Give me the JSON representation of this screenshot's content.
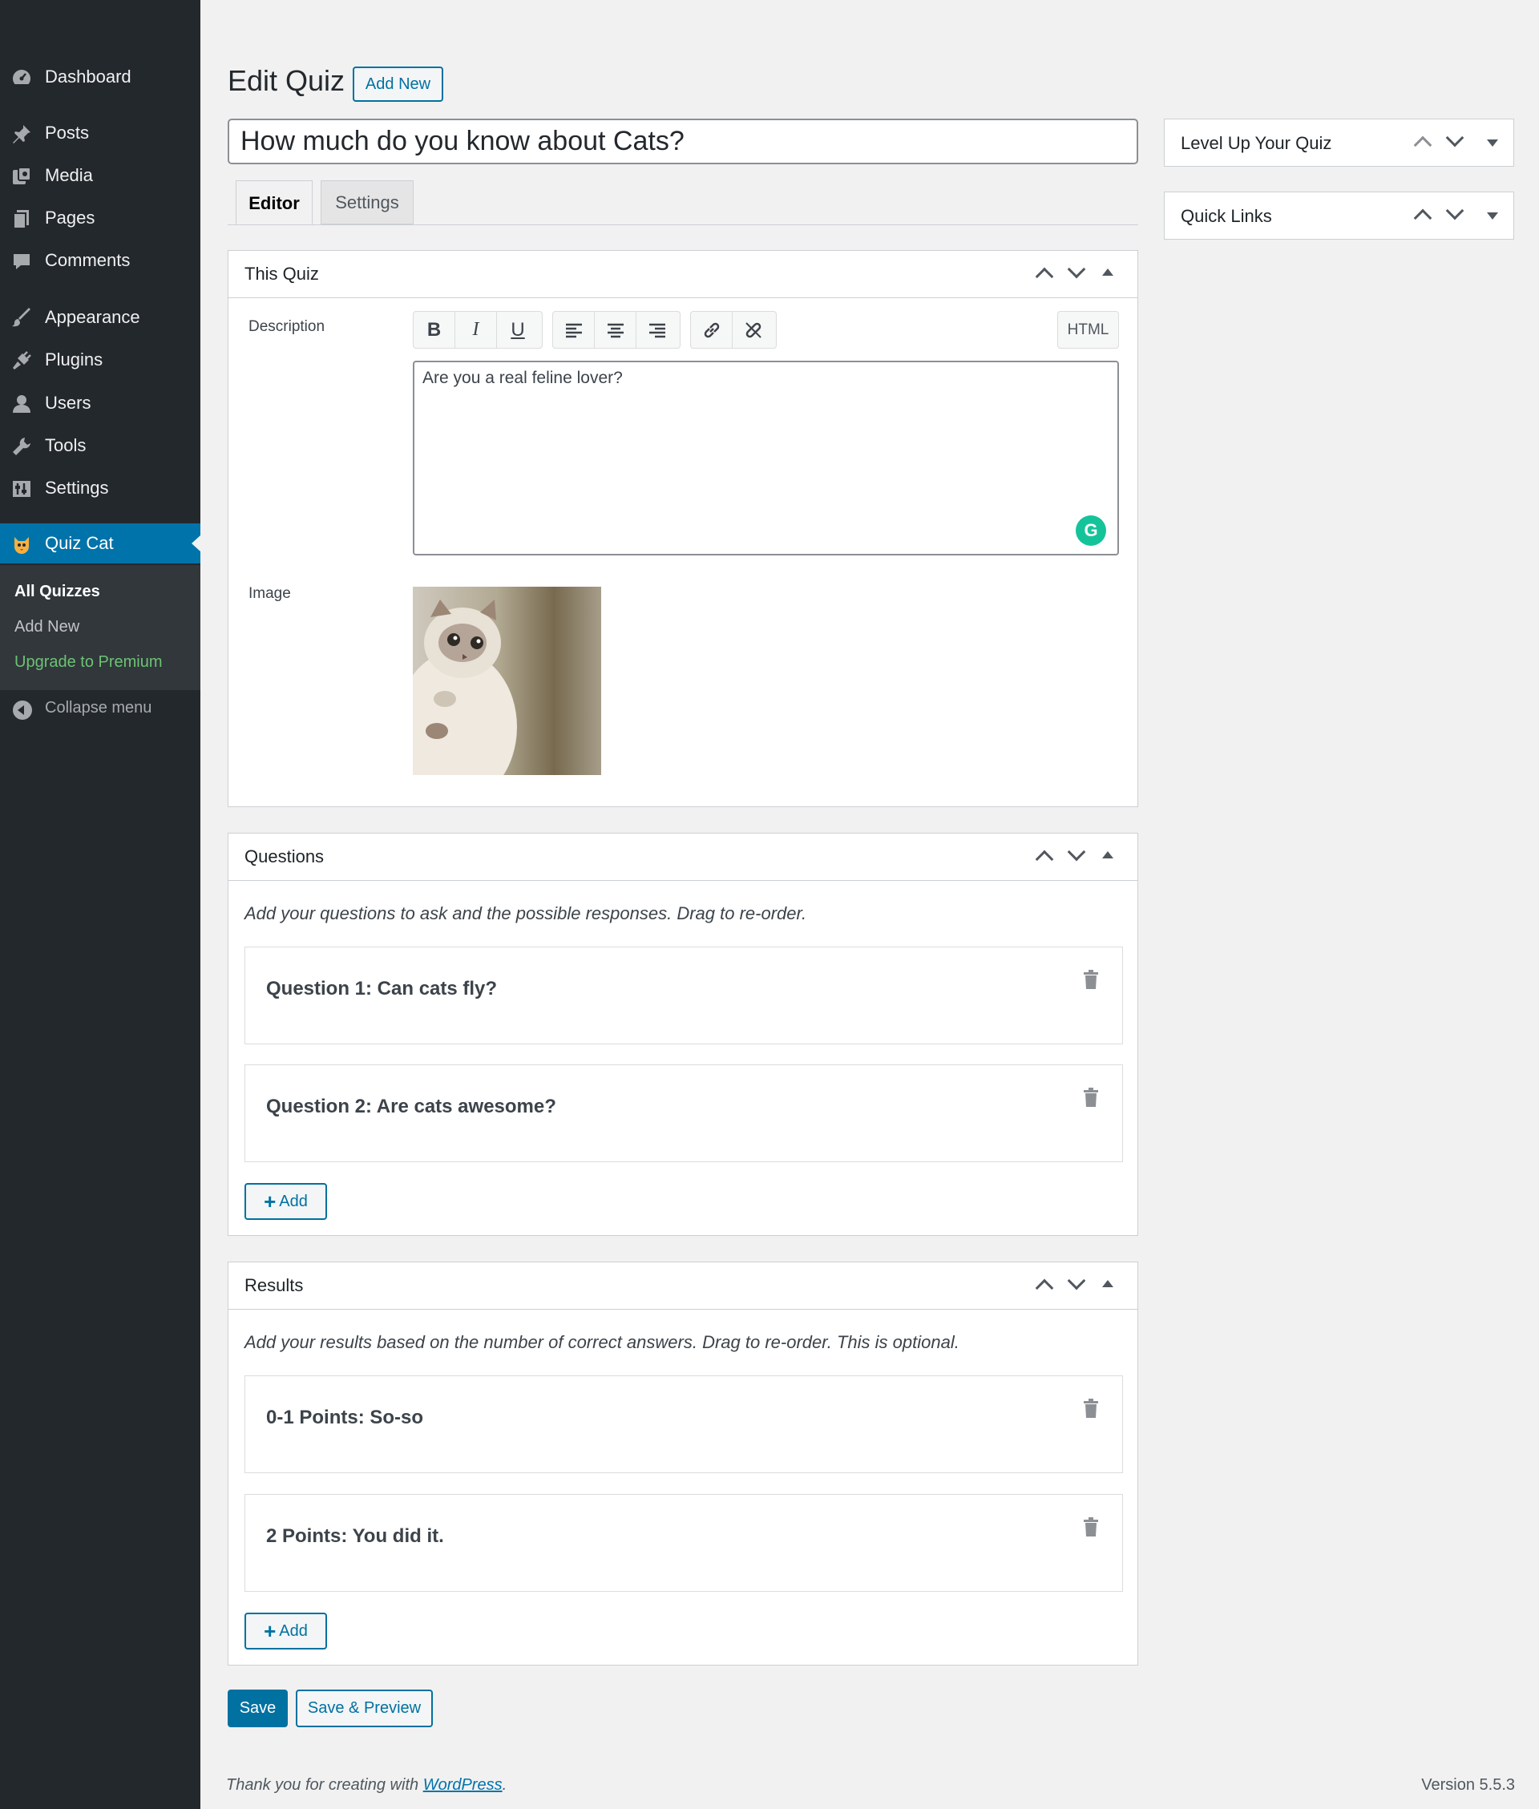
{
  "sidebar": {
    "items": [
      {
        "label": "Dashboard",
        "icon": "dashboard-icon"
      },
      {
        "label": "Posts",
        "icon": "pin-icon"
      },
      {
        "label": "Media",
        "icon": "media-icon"
      },
      {
        "label": "Pages",
        "icon": "pages-icon"
      },
      {
        "label": "Comments",
        "icon": "comment-icon"
      },
      {
        "label": "Appearance",
        "icon": "brush-icon"
      },
      {
        "label": "Plugins",
        "icon": "plug-icon"
      },
      {
        "label": "Users",
        "icon": "user-icon"
      },
      {
        "label": "Tools",
        "icon": "wrench-icon"
      },
      {
        "label": "Settings",
        "icon": "settings-icon"
      },
      {
        "label": "Quiz Cat",
        "icon": "cat-icon"
      }
    ],
    "submenu": [
      "All Quizzes",
      "Add New",
      "Upgrade to Premium"
    ],
    "collapse_label": "Collapse menu"
  },
  "header": {
    "title": "Edit Quiz",
    "add_new_label": "Add New"
  },
  "quiz_title_value": "How much do you know about Cats?",
  "tabs": [
    "Editor",
    "Settings"
  ],
  "panels": {
    "this_quiz": {
      "title": "This Quiz",
      "description_label": "Description",
      "html_label": "HTML",
      "description_value": "Are you a real feline lover?",
      "image_label": "Image",
      "toolbar": [
        "B",
        "I",
        "U"
      ]
    },
    "questions": {
      "title": "Questions",
      "help": "Add your questions to ask and the possible responses. Drag to re-order.",
      "items": [
        "Question 1: Can cats fly?",
        "Question 2: Are cats awesome?"
      ],
      "add_label": "Add"
    },
    "results": {
      "title": "Results",
      "help": "Add your results based on the number of correct answers. Drag to re-order. This is optional.",
      "items": [
        "0-1 Points: So-so",
        "2 Points: You did it."
      ],
      "add_label": "Add"
    }
  },
  "actions": {
    "save_label": "Save",
    "save_preview_label": "Save & Preview"
  },
  "side": {
    "level_up_title": "Level Up Your Quiz",
    "quick_links_title": "Quick Links"
  },
  "footer": {
    "thanks_prefix": "Thank you for creating with ",
    "thanks_link": "WordPress",
    "thanks_suffix": ".",
    "version": "Version 5.5.3"
  },
  "colors": {
    "sidebar_bg": "#23282d",
    "accent": "#0073aa",
    "premium_green": "#6bc373",
    "grammarly_green": "#15c39a"
  }
}
